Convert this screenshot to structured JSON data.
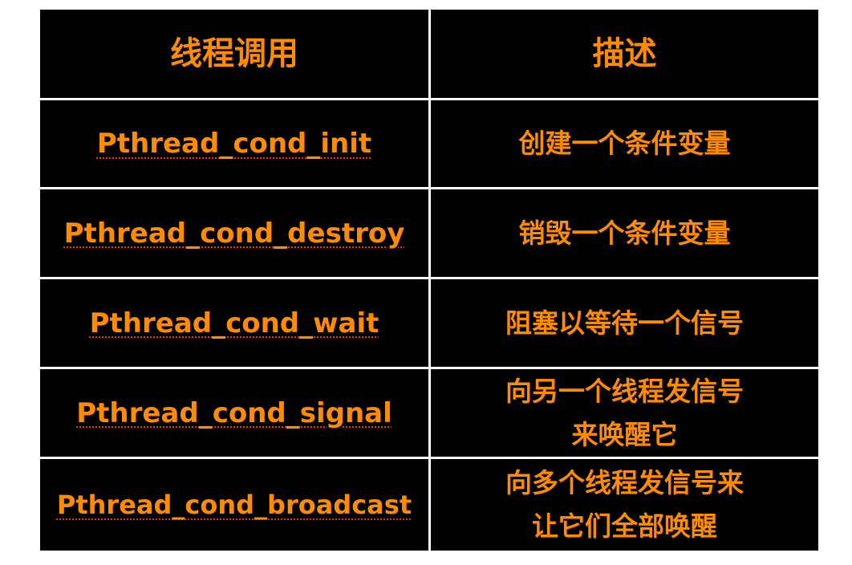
{
  "table": {
    "headers": {
      "call": "线程调用",
      "description": "描述"
    },
    "rows": [
      {
        "call": "Pthread_cond_init",
        "description": "创建一个条件变量"
      },
      {
        "call": "Pthread_cond_destroy",
        "description": "销毁一个条件变量"
      },
      {
        "call": "Pthread_cond_wait",
        "description": "阻塞以等待一个信号"
      },
      {
        "call": "Pthread_cond_signal",
        "description": "向另一个线程发信号\n来唤醒它"
      },
      {
        "call": "Pthread_cond_broadcast",
        "description": "向多个线程发信号来\n让它们全部唤醒"
      }
    ],
    "colors": {
      "background": "#000000",
      "grid": "#ffffff",
      "text": "#ff8c00",
      "spellcheck_underline": "#ff2020"
    }
  }
}
